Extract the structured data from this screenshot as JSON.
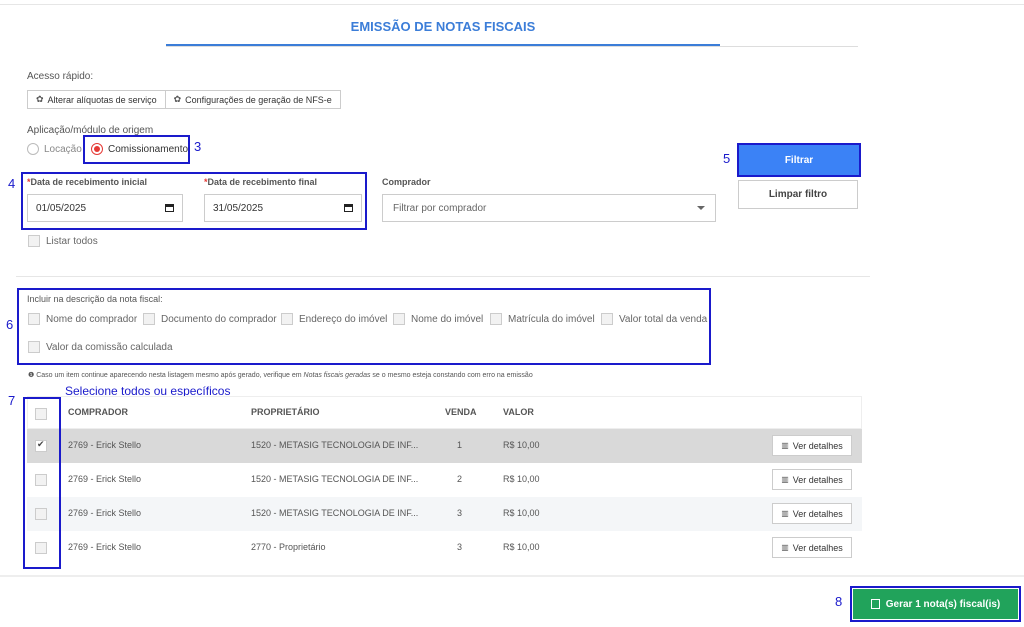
{
  "page_title": "EMISSÃO DE NOTAS FISCAIS",
  "quick_access": {
    "label": "Acesso rápido:",
    "buttons": [
      "Alterar alíquotas de serviço",
      "Configurações de geração de NFS-e"
    ]
  },
  "origin": {
    "label": "Aplicação/módulo de origem",
    "options": [
      "Locação",
      "Comissionamento"
    ],
    "selected": "Comissionamento"
  },
  "filters": {
    "start_label": "*Data de recebimento inicial",
    "start_value": "01/05/2025",
    "end_label": "*Data de recebimento final",
    "end_value": "31/05/2025",
    "buyer_label": "Comprador",
    "buyer_placeholder": "Filtrar por comprador",
    "list_all": "Listar todos",
    "filter_button": "Filtrar",
    "clear_button": "Limpar filtro"
  },
  "description": {
    "label": "Incluir na descrição da nota fiscal:",
    "options": [
      "Nome do comprador",
      "Documento do comprador",
      "Endereço do imóvel",
      "Nome do imóvel",
      "Matrícula do imóvel",
      "Valor total da venda",
      "Valor da comissão calculada"
    ]
  },
  "note": {
    "prefix": "Caso um item continue aparecendo nesta listagem mesmo após gerado, verifique em ",
    "emphasis": "Notas fiscais geradas",
    "suffix": " se o mesmo esteja constando com erro na emissão"
  },
  "table": {
    "headers": [
      "COMPRADOR",
      "PROPRIETÁRIO",
      "VENDA",
      "VALOR"
    ],
    "details_label": "Ver detalhes",
    "rows": [
      {
        "buyer": "2769 - Erick Stello",
        "owner": "1520 - METASIG TECNOLOGIA DE INF...",
        "sale": "1",
        "value": "R$ 10,00",
        "checked": true
      },
      {
        "buyer": "2769 - Erick Stello",
        "owner": "1520 - METASIG TECNOLOGIA DE INF...",
        "sale": "2",
        "value": "R$ 10,00",
        "checked": false
      },
      {
        "buyer": "2769 - Erick Stello",
        "owner": "1520 - METASIG TECNOLOGIA DE INF...",
        "sale": "3",
        "value": "R$ 10,00",
        "checked": false
      },
      {
        "buyer": "2769 - Erick Stello",
        "owner": "2770 - Proprietário",
        "sale": "3",
        "value": "R$ 10,00",
        "checked": false
      }
    ]
  },
  "generate_button": "Gerar 1 nota(s) fiscal(is)",
  "annotations": {
    "n3": "3",
    "n4": "4",
    "n5": "5",
    "n6": "6",
    "n7": "7",
    "n8": "8",
    "hint7": "Selecione todos ou específicos"
  },
  "colors": {
    "accent": "#3b82f6",
    "annotation": "#1a1acb",
    "success": "#21a35b",
    "radio_selected": "#e53935"
  }
}
